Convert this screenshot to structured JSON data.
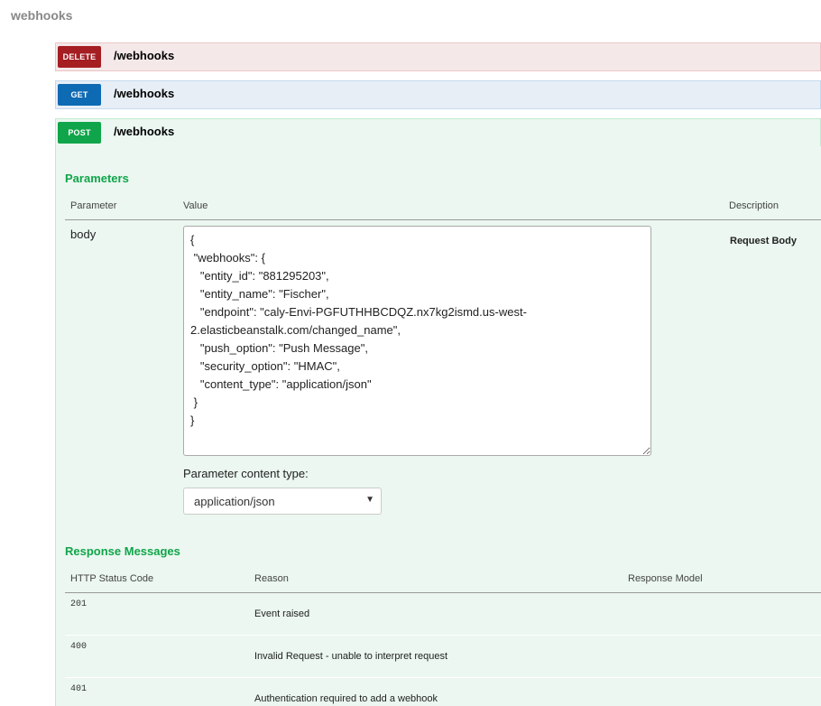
{
  "section": {
    "title": "webhooks"
  },
  "operations": [
    {
      "method": "DELETE",
      "path": "/webhooks"
    },
    {
      "method": "GET",
      "path": "/webhooks"
    },
    {
      "method": "POST",
      "path": "/webhooks"
    }
  ],
  "colors": {
    "delete": "#a41e22",
    "get": "#0f6ab4",
    "post": "#10a54a"
  },
  "parameters": {
    "heading": "Parameters",
    "columns": {
      "parameter": "Parameter",
      "value": "Value",
      "description": "Description"
    },
    "row": {
      "name": "body",
      "value": "{\n \"webhooks\": {\n   \"entity_id\": \"881295203\",\n   \"entity_name\": \"Fischer\",\n   \"endpoint\": \"caly-Envi-PGFUTHHBCDQZ.nx7kg2ismd.us-west-2.elasticbeanstalk.com/changed_name\",\n   \"push_option\": \"Push Message\",\n   \"security_option\": \"HMAC\",\n   \"content_type\": \"application/json\"\n }\n}",
      "description": "Request Body"
    },
    "content_type_label": "Parameter content type:",
    "content_type_value": "application/json"
  },
  "responses": {
    "heading": "Response Messages",
    "columns": {
      "status": "HTTP Status Code",
      "reason": "Reason",
      "model": "Response Model"
    },
    "rows": [
      {
        "code": "201",
        "reason": "Event raised"
      },
      {
        "code": "400",
        "reason": "Invalid Request - unable to interpret request"
      },
      {
        "code": "401",
        "reason": "Authentication required to add a webhook"
      }
    ]
  }
}
